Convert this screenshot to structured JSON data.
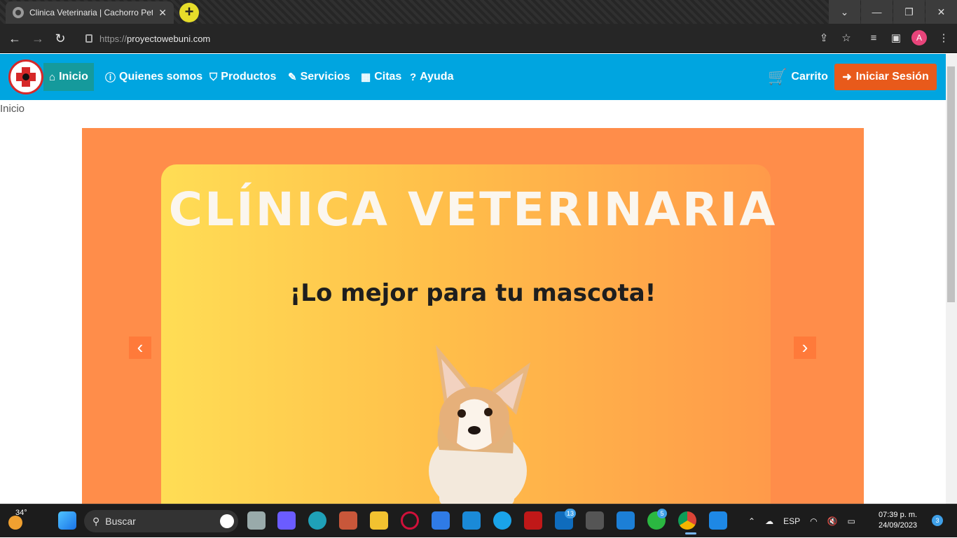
{
  "browser": {
    "tab_title": "Clinica Veterinaria | Cachorro Pet",
    "url_scheme": "https://",
    "url_host": "proyectowebuni.com",
    "profile_initial": "A"
  },
  "nav": {
    "items": [
      {
        "label": "Inicio",
        "icon": "home-icon"
      },
      {
        "label": "Quienes somos",
        "icon": "info-icon"
      },
      {
        "label": "Productos",
        "icon": "shield-icon"
      },
      {
        "label": "Servicios",
        "icon": "syringe-icon"
      },
      {
        "label": "Citas",
        "icon": "calendar-icon"
      },
      {
        "label": "Ayuda",
        "icon": "help-icon"
      }
    ],
    "cart_label": "Carrito",
    "login_label": "Iniciar Sesión"
  },
  "breadcrumb": "Inicio",
  "hero": {
    "title": "CLÍNICA VETERINARIA",
    "subtitle": "¡Lo mejor para tu mascota!"
  },
  "taskbar": {
    "weather_temp": "34°",
    "search_placeholder": "Buscar",
    "language": "ESP",
    "time": "07:39 p. m.",
    "date": "24/09/2023",
    "notifications": "3",
    "badge_mail": "13",
    "badge_whatsapp": "5"
  },
  "colors": {
    "navbar": "#00a5e0",
    "active_nav": "#159a9c",
    "login_button": "#e85a1b",
    "hero_bg": "#ff8d4a"
  }
}
